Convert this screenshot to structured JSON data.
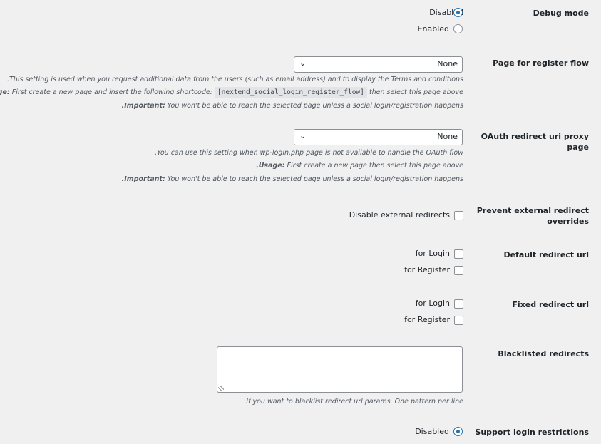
{
  "debug_mode": {
    "label": "Debug mode",
    "options": [
      "Disabled",
      "Enabled"
    ],
    "selected": "Disabled"
  },
  "register_flow": {
    "label": "Page for register flow",
    "value": "None",
    "desc1": ".This setting is used when you request additional data from the users (such as email address) and to display the Terms and conditions",
    "desc2_strong": "Usage:",
    "desc2_text": " First create a new page and insert the following shortcode: ",
    "desc2_code": "[nextend_social_login_register_flow]",
    "desc2_tail": " then select this page above",
    "desc3_strong": ".Important:",
    "desc3_text": " You won't be able to reach the selected page unless a social login/registration happens"
  },
  "oauth_proxy": {
    "label_line1": "OAuth redirect uri proxy",
    "label_line2": "page",
    "value": "None",
    "desc1": ".You can use this setting when wp-login.php page is not available to handle the OAuth flow",
    "desc2_strong": ".Usage:",
    "desc2_text": " First create a new page then select this page above",
    "desc3_strong": ".Important:",
    "desc3_text": " You won't be able to reach the selected page unless a social login/registration happens"
  },
  "prevent_external": {
    "label_line1": "Prevent external redirect",
    "label_line2": "overrides",
    "option": "Disable external redirects",
    "checked": false
  },
  "default_redirect": {
    "label": "Default redirect url",
    "options": [
      "for Login",
      "for Register"
    ],
    "checked": [
      false,
      false
    ]
  },
  "fixed_redirect": {
    "label": "Fixed redirect url",
    "options": [
      "for Login",
      "for Register"
    ],
    "checked": [
      false,
      false
    ]
  },
  "blacklisted": {
    "label": "Blacklisted redirects",
    "value": "",
    "desc": ".If you want to blacklist redirect url params. One pattern per line"
  },
  "login_restrictions": {
    "label": "Support login restrictions",
    "options": [
      "Disabled"
    ],
    "selected": "Disabled"
  },
  "colors": {
    "accent": "#2271b1",
    "background": "#f0f0f1"
  }
}
